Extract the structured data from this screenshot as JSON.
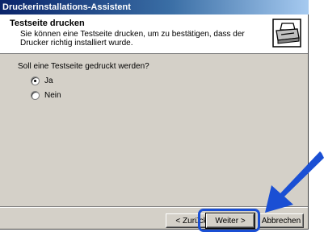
{
  "window": {
    "title": "Druckerinstallations-Assistent"
  },
  "header": {
    "title": "Testseite drucken",
    "subtitle": "Sie können eine Testseite drucken, um zu bestätigen, dass der Drucker richtig installiert wurde."
  },
  "main": {
    "question": "Soll eine Testseite gedruckt werden?",
    "options": [
      {
        "label": "Ja",
        "selected": true
      },
      {
        "label": "Nein",
        "selected": false
      }
    ]
  },
  "footer": {
    "back_label": "< Zurück",
    "next_label": "Weiter >",
    "cancel_label": "Abbrechen"
  },
  "colors": {
    "highlight": "#1a4fd4",
    "titlebar": "#0a246a",
    "dialog_bg": "#d4d0c8"
  },
  "icons": [
    "printer-icon",
    "pointer-arrow-icon"
  ]
}
